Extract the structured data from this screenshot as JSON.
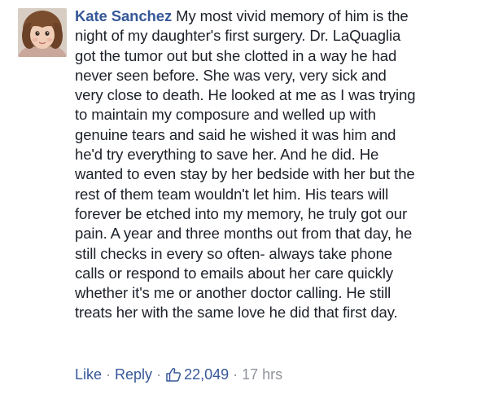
{
  "comment": {
    "author": "Kate Sanchez",
    "lines": [
      " My most vivid memory of him is the",
      "night of my daughter's first surgery. Dr. LaQuaglia",
      "got the tumor out but she clotted in a way he had",
      "never seen before. She was very, very sick and",
      "very close to death. He looked at me as I was trying",
      "to maintain my composure and welled up with",
      "genuine tears and said he wished it was him and",
      "he'd try everything to save her. And he did. He",
      "wanted to even stay by her bedside with her but the",
      "rest of them team wouldn't let him. His tears will",
      "forever be etched into my memory, he truly got our",
      "pain. A year and three months out from that day, he",
      "still checks in every so often- always take phone",
      "calls or respond to emails about her care quickly",
      "whether it's me or another doctor calling. He still",
      "treats her with the same love he did that first day."
    ]
  },
  "actions": {
    "like_label": "Like",
    "reply_label": "Reply",
    "separator": "·",
    "like_count": "22,049",
    "timestamp": "17 hrs"
  },
  "icons": {
    "like": "thumbs-up-outline-icon",
    "avatar": "profile-photo-child"
  },
  "colors": {
    "link": "#365899",
    "text": "#1d2129",
    "meta": "#90949c"
  }
}
